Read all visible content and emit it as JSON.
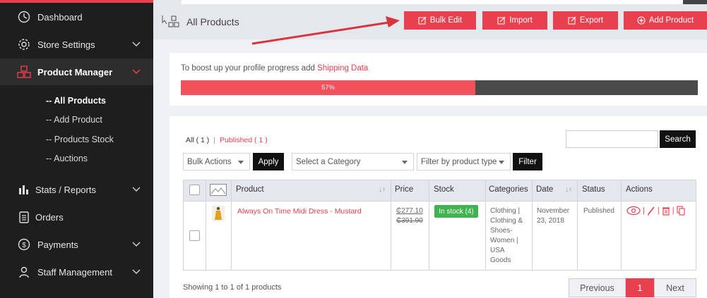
{
  "sidebar": {
    "items": [
      {
        "label": "Dashboard",
        "icon": "dashboard-icon"
      },
      {
        "label": "Store Settings",
        "icon": "gear-icon"
      },
      {
        "label": "Product Manager",
        "icon": "boxes-icon"
      },
      {
        "label": "Stats / Reports",
        "icon": "bar-chart-icon"
      },
      {
        "label": "Orders",
        "icon": "clipboard-icon"
      },
      {
        "label": "Payments",
        "icon": "dollar-icon"
      },
      {
        "label": "Staff Management",
        "icon": "user-icon"
      }
    ],
    "sub_items": [
      "-- All Products",
      "-- Add Product",
      "-- Products Stock",
      "-- Auctions"
    ]
  },
  "header": {
    "title": "All Products",
    "buttons": [
      "Bulk Edit",
      "Import",
      "Export",
      "Add Product"
    ]
  },
  "progress": {
    "text": "To boost up your profile progress add",
    "link": "Shipping Data",
    "percent_label": "57%",
    "percent": 57
  },
  "filters": {
    "all_label": "All ( 1 )",
    "published_label": "Published ( 1 )",
    "bulk_actions": "Bulk Actions",
    "apply": "Apply",
    "category": "Select a Category",
    "product_type": "Filter by product type",
    "filter": "Filter",
    "search_placeholder": "",
    "search": "Search"
  },
  "table": {
    "headers": [
      "Product",
      "Price",
      "Stock",
      "Categories",
      "Date",
      "Status",
      "Actions"
    ],
    "row": {
      "product": "Always On Time Midi Dress - Mustard",
      "price_sale": "₵277.10",
      "price_regular": "₵391.90",
      "stock": "In stock (4)",
      "categories": [
        "Clothing |",
        "Clothing &",
        "Shoes-",
        "Women |",
        "USA",
        "Goods"
      ],
      "date_line1": "November",
      "date_line2": "23, 2018",
      "status": "Published"
    }
  },
  "footer": {
    "showing": "Showing 1 to 1 of 1 products",
    "previous": "Previous",
    "page": "1",
    "next": "Next"
  },
  "colors": {
    "accent": "#e8404f",
    "sidebar_bg": "#1e1e1e",
    "stock_green": "#3fb34f"
  }
}
